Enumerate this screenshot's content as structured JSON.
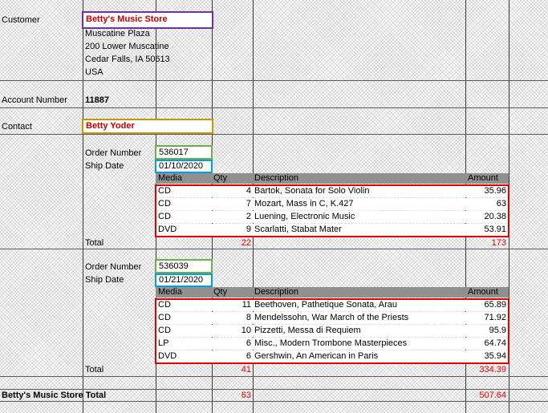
{
  "customer": {
    "label": "Customer",
    "name": "Betty's Music Store",
    "address": [
      "Muscatine Plaza",
      "200 Lower Muscatine",
      "Cedar Falls, IA 50613",
      "USA"
    ]
  },
  "account": {
    "label": "Account Number",
    "value": "11887"
  },
  "contact": {
    "label": "Contact",
    "value": "Betty Yoder"
  },
  "labels": {
    "order_number": "Order Number",
    "ship_date": "Ship Date",
    "total": "Total",
    "col_media": "Media",
    "col_qty": "Qty",
    "col_description": "Description",
    "col_amount": "Amount"
  },
  "orders": [
    {
      "number": "536017",
      "ship_date": "01/10/2020",
      "rows": [
        {
          "media": "CD",
          "qty": "4",
          "description": "Bartok, Sonata for Solo Violin",
          "amount": "35.96"
        },
        {
          "media": "CD",
          "qty": "7",
          "description": "Mozart, Mass in C, K.427",
          "amount": "63"
        },
        {
          "media": "CD",
          "qty": "2",
          "description": "Luening, Electronic Music",
          "amount": "20.38"
        },
        {
          "media": "DVD",
          "qty": "9",
          "description": "Scarlatti, Stabat Mater",
          "amount": "53.91"
        }
      ],
      "total_qty": "22",
      "total_amount": "173"
    },
    {
      "number": "536039",
      "ship_date": "01/21/2020",
      "rows": [
        {
          "media": "CD",
          "qty": "11",
          "description": "Beethoven, Pathetique Sonata, Arau",
          "amount": "65.89"
        },
        {
          "media": "CD",
          "qty": "8",
          "description": "Mendelssohn, War March of the Priests",
          "amount": "71.92"
        },
        {
          "media": "CD",
          "qty": "10",
          "description": "Pizzetti, Messa di Requiem",
          "amount": "95.9"
        },
        {
          "media": "LP",
          "qty": "6",
          "description": "Misc., Modern Trombone Masterpieces",
          "amount": "64.74"
        },
        {
          "media": "DVD",
          "qty": "6",
          "description": "Gershwin, An American in Paris",
          "amount": "35.94"
        }
      ],
      "total_qty": "41",
      "total_amount": "334.39"
    }
  ],
  "grand_total": {
    "label": "Betty's Music Store Total",
    "qty": "63",
    "amount": "507.64"
  },
  "colors": {
    "customer_box": "#7030a0",
    "contact_box": "#c8960a",
    "order_box": "#70ad47",
    "date_box": "#00a0e0",
    "rows_frame": "#e00000",
    "total_text": "#e00000",
    "customer_name_text": "#c00000",
    "header_fill": "#909090"
  }
}
